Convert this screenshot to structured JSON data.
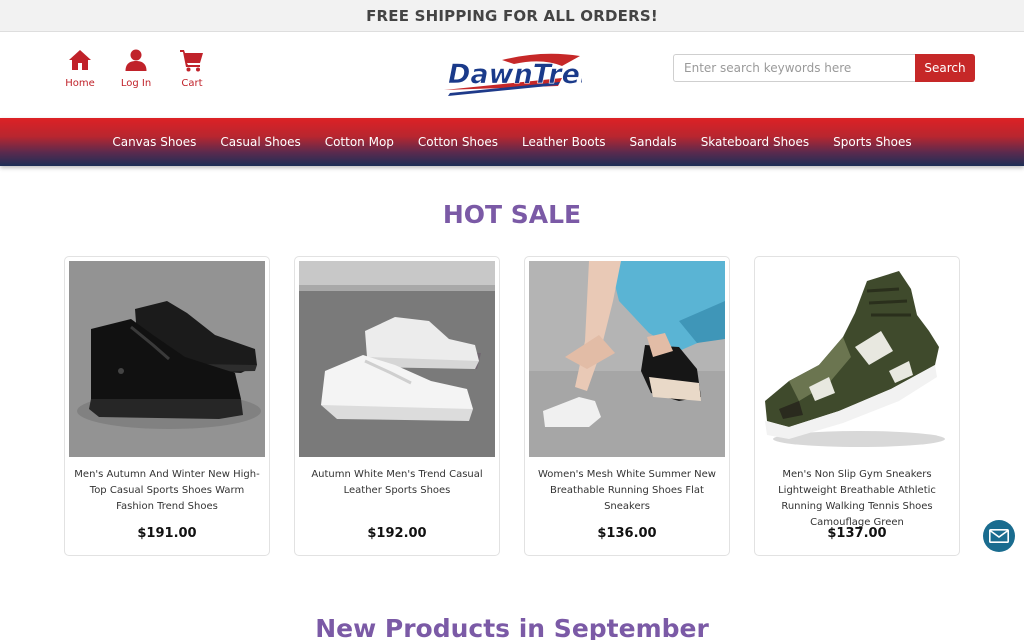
{
  "topbar": {
    "text": "FREE SHIPPING FOR ALL ORDERS!"
  },
  "header": {
    "links": {
      "home": "Home",
      "login": "Log In",
      "cart": "Cart"
    },
    "logo_text": "DawnTrek",
    "search": {
      "placeholder": "Enter search keywords here",
      "value": "",
      "button": "Search"
    }
  },
  "nav": {
    "items": [
      "Canvas Shoes",
      "Casual Shoes",
      "Cotton Mop",
      "Cotton Shoes",
      "Leather Boots",
      "Sandals",
      "Skateboard Shoes",
      "Sports Shoes"
    ]
  },
  "hot_sale": {
    "title": "HOT SALE",
    "products": [
      {
        "name": "Men's Autumn And Winter New High-Top Casual Sports Shoes Warm Fashion Trend Shoes",
        "price": "$191.00",
        "image_icon": "black-high-top-shoes-photo"
      },
      {
        "name": "Autumn White Men's Trend Casual Leather Sports Shoes",
        "price": "$192.00",
        "image_icon": "white-leather-shoes-photo"
      },
      {
        "name": "Women's Mesh White Summer New Breathable Running Shoes Flat Sneakers",
        "price": "$136.00",
        "image_icon": "woman-tying-sneakers-photo"
      },
      {
        "name": "Men's Non Slip Gym Sneakers Lightweight Breathable Athletic Running Walking Tennis Shoes Camouflage Green",
        "price": "$137.00",
        "image_icon": "camouflage-sneaker-photo"
      }
    ]
  },
  "new_products": {
    "title": "New Products in September"
  },
  "colors": {
    "brand_red": "#c62828",
    "accent_purple": "#7b5aa6",
    "nav_bottom": "#1e2e56",
    "chat_blue": "#1a6c8f"
  }
}
